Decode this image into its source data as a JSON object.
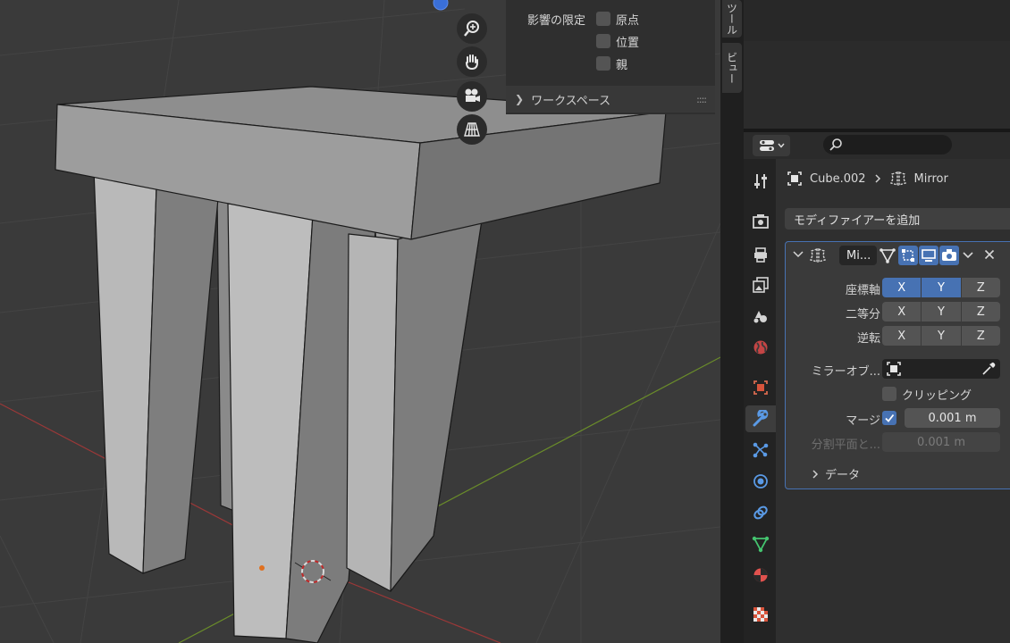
{
  "overlay": {
    "limit_label": "影響の限定",
    "options": [
      "原点",
      "位置",
      "親"
    ],
    "workspace_label": "ワークスペース"
  },
  "npanel_tabs": [
    "ツール",
    "ビュー"
  ],
  "properties": {
    "breadcrumb_object": "Cube.002",
    "breadcrumb_modifier": "Mirror",
    "add_modifier": "モディファイアーを追加",
    "modifier": {
      "name": "Mi...",
      "axis_label": "座標軸",
      "bisect_label": "二等分",
      "flip_label": "逆転",
      "axes": [
        "X",
        "Y",
        "Z"
      ],
      "axis_active": [
        true,
        true,
        false
      ],
      "mirror_object_label": "ミラーオブ...",
      "clipping_label": "クリッピング",
      "clipping_checked": false,
      "merge_label": "マージ",
      "merge_checked": true,
      "merge_value": "0.001 m",
      "bisect_distance_label": "分割平面と...",
      "bisect_distance_value": "0.001 m",
      "data_label": "データ"
    }
  },
  "colors": {
    "accent": "#4772b3",
    "panel": "#3a3a3a",
    "x_axis": "#9b3838",
    "y_axis": "#6a8c2a"
  }
}
